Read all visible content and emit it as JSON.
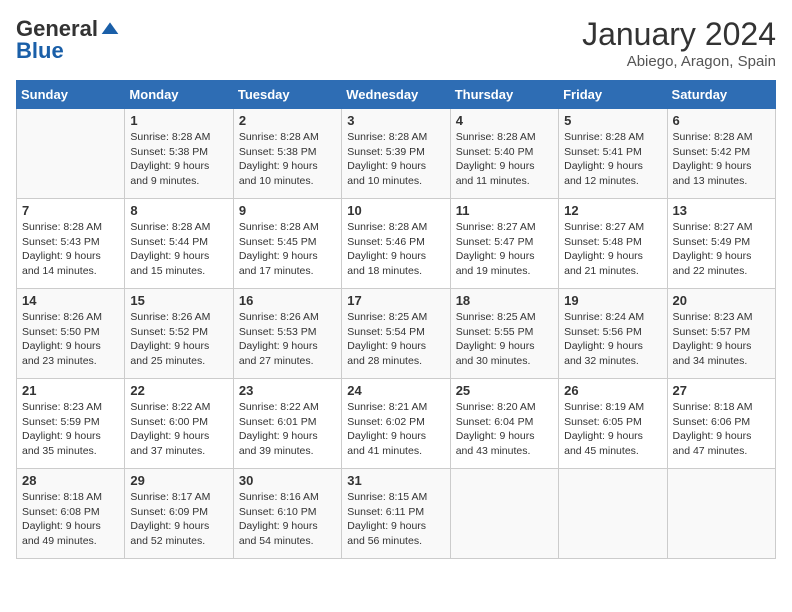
{
  "logo": {
    "general": "General",
    "blue": "Blue"
  },
  "title": "January 2024",
  "location": "Abiego, Aragon, Spain",
  "days_header": [
    "Sunday",
    "Monday",
    "Tuesday",
    "Wednesday",
    "Thursday",
    "Friday",
    "Saturday"
  ],
  "weeks": [
    [
      {
        "day": "",
        "sunrise": "",
        "sunset": "",
        "daylight": ""
      },
      {
        "day": "1",
        "sunrise": "Sunrise: 8:28 AM",
        "sunset": "Sunset: 5:38 PM",
        "daylight": "Daylight: 9 hours and 9 minutes."
      },
      {
        "day": "2",
        "sunrise": "Sunrise: 8:28 AM",
        "sunset": "Sunset: 5:38 PM",
        "daylight": "Daylight: 9 hours and 10 minutes."
      },
      {
        "day": "3",
        "sunrise": "Sunrise: 8:28 AM",
        "sunset": "Sunset: 5:39 PM",
        "daylight": "Daylight: 9 hours and 10 minutes."
      },
      {
        "day": "4",
        "sunrise": "Sunrise: 8:28 AM",
        "sunset": "Sunset: 5:40 PM",
        "daylight": "Daylight: 9 hours and 11 minutes."
      },
      {
        "day": "5",
        "sunrise": "Sunrise: 8:28 AM",
        "sunset": "Sunset: 5:41 PM",
        "daylight": "Daylight: 9 hours and 12 minutes."
      },
      {
        "day": "6",
        "sunrise": "Sunrise: 8:28 AM",
        "sunset": "Sunset: 5:42 PM",
        "daylight": "Daylight: 9 hours and 13 minutes."
      }
    ],
    [
      {
        "day": "7",
        "sunrise": "Sunrise: 8:28 AM",
        "sunset": "Sunset: 5:43 PM",
        "daylight": "Daylight: 9 hours and 14 minutes."
      },
      {
        "day": "8",
        "sunrise": "Sunrise: 8:28 AM",
        "sunset": "Sunset: 5:44 PM",
        "daylight": "Daylight: 9 hours and 15 minutes."
      },
      {
        "day": "9",
        "sunrise": "Sunrise: 8:28 AM",
        "sunset": "Sunset: 5:45 PM",
        "daylight": "Daylight: 9 hours and 17 minutes."
      },
      {
        "day": "10",
        "sunrise": "Sunrise: 8:28 AM",
        "sunset": "Sunset: 5:46 PM",
        "daylight": "Daylight: 9 hours and 18 minutes."
      },
      {
        "day": "11",
        "sunrise": "Sunrise: 8:27 AM",
        "sunset": "Sunset: 5:47 PM",
        "daylight": "Daylight: 9 hours and 19 minutes."
      },
      {
        "day": "12",
        "sunrise": "Sunrise: 8:27 AM",
        "sunset": "Sunset: 5:48 PM",
        "daylight": "Daylight: 9 hours and 21 minutes."
      },
      {
        "day": "13",
        "sunrise": "Sunrise: 8:27 AM",
        "sunset": "Sunset: 5:49 PM",
        "daylight": "Daylight: 9 hours and 22 minutes."
      }
    ],
    [
      {
        "day": "14",
        "sunrise": "Sunrise: 8:26 AM",
        "sunset": "Sunset: 5:50 PM",
        "daylight": "Daylight: 9 hours and 23 minutes."
      },
      {
        "day": "15",
        "sunrise": "Sunrise: 8:26 AM",
        "sunset": "Sunset: 5:52 PM",
        "daylight": "Daylight: 9 hours and 25 minutes."
      },
      {
        "day": "16",
        "sunrise": "Sunrise: 8:26 AM",
        "sunset": "Sunset: 5:53 PM",
        "daylight": "Daylight: 9 hours and 27 minutes."
      },
      {
        "day": "17",
        "sunrise": "Sunrise: 8:25 AM",
        "sunset": "Sunset: 5:54 PM",
        "daylight": "Daylight: 9 hours and 28 minutes."
      },
      {
        "day": "18",
        "sunrise": "Sunrise: 8:25 AM",
        "sunset": "Sunset: 5:55 PM",
        "daylight": "Daylight: 9 hours and 30 minutes."
      },
      {
        "day": "19",
        "sunrise": "Sunrise: 8:24 AM",
        "sunset": "Sunset: 5:56 PM",
        "daylight": "Daylight: 9 hours and 32 minutes."
      },
      {
        "day": "20",
        "sunrise": "Sunrise: 8:23 AM",
        "sunset": "Sunset: 5:57 PM",
        "daylight": "Daylight: 9 hours and 34 minutes."
      }
    ],
    [
      {
        "day": "21",
        "sunrise": "Sunrise: 8:23 AM",
        "sunset": "Sunset: 5:59 PM",
        "daylight": "Daylight: 9 hours and 35 minutes."
      },
      {
        "day": "22",
        "sunrise": "Sunrise: 8:22 AM",
        "sunset": "Sunset: 6:00 PM",
        "daylight": "Daylight: 9 hours and 37 minutes."
      },
      {
        "day": "23",
        "sunrise": "Sunrise: 8:22 AM",
        "sunset": "Sunset: 6:01 PM",
        "daylight": "Daylight: 9 hours and 39 minutes."
      },
      {
        "day": "24",
        "sunrise": "Sunrise: 8:21 AM",
        "sunset": "Sunset: 6:02 PM",
        "daylight": "Daylight: 9 hours and 41 minutes."
      },
      {
        "day": "25",
        "sunrise": "Sunrise: 8:20 AM",
        "sunset": "Sunset: 6:04 PM",
        "daylight": "Daylight: 9 hours and 43 minutes."
      },
      {
        "day": "26",
        "sunrise": "Sunrise: 8:19 AM",
        "sunset": "Sunset: 6:05 PM",
        "daylight": "Daylight: 9 hours and 45 minutes."
      },
      {
        "day": "27",
        "sunrise": "Sunrise: 8:18 AM",
        "sunset": "Sunset: 6:06 PM",
        "daylight": "Daylight: 9 hours and 47 minutes."
      }
    ],
    [
      {
        "day": "28",
        "sunrise": "Sunrise: 8:18 AM",
        "sunset": "Sunset: 6:08 PM",
        "daylight": "Daylight: 9 hours and 49 minutes."
      },
      {
        "day": "29",
        "sunrise": "Sunrise: 8:17 AM",
        "sunset": "Sunset: 6:09 PM",
        "daylight": "Daylight: 9 hours and 52 minutes."
      },
      {
        "day": "30",
        "sunrise": "Sunrise: 8:16 AM",
        "sunset": "Sunset: 6:10 PM",
        "daylight": "Daylight: 9 hours and 54 minutes."
      },
      {
        "day": "31",
        "sunrise": "Sunrise: 8:15 AM",
        "sunset": "Sunset: 6:11 PM",
        "daylight": "Daylight: 9 hours and 56 minutes."
      },
      {
        "day": "",
        "sunrise": "",
        "sunset": "",
        "daylight": ""
      },
      {
        "day": "",
        "sunrise": "",
        "sunset": "",
        "daylight": ""
      },
      {
        "day": "",
        "sunrise": "",
        "sunset": "",
        "daylight": ""
      }
    ]
  ]
}
